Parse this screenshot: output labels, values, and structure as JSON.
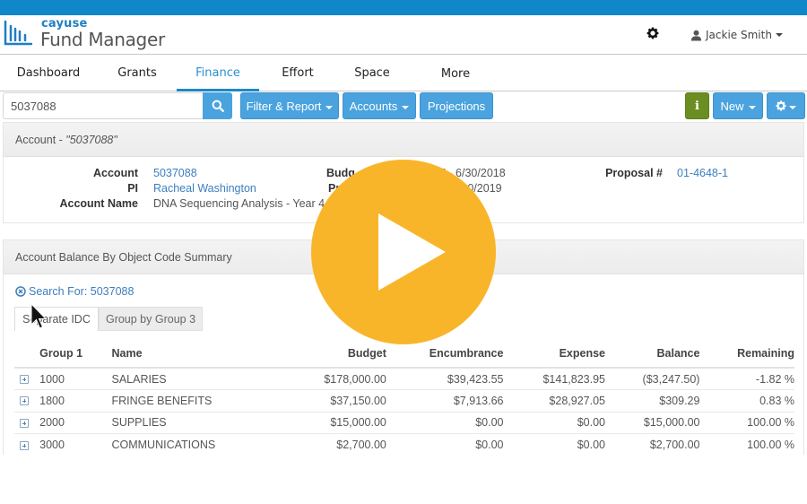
{
  "header": {
    "brand": "cayuse",
    "product": "Fund Manager",
    "settings_icon": "gear-icon",
    "user_name": "Jackie Smith",
    "user_icon": "user-icon"
  },
  "nav": {
    "tabs": [
      {
        "label": "Dashboard",
        "active": false
      },
      {
        "label": "Grants",
        "active": false
      },
      {
        "label": "Finance",
        "active": true
      },
      {
        "label": "Effort",
        "active": false
      },
      {
        "label": "Space",
        "active": false
      },
      {
        "label": "More",
        "active": false
      }
    ]
  },
  "toolbar": {
    "search_value": "5037088",
    "search_icon": "search-icon",
    "filter_report_label": "Filter & Report",
    "accounts_label": "Accounts",
    "projections_label": "Projections",
    "info_label": "i",
    "new_label": "New",
    "settings_icon": "gear-icon"
  },
  "account_panel": {
    "title_prefix": "Account - ",
    "title_value": "\"5037088\"",
    "fields": {
      "account_label": "Account",
      "account_value": "5037088",
      "pi_label": "PI",
      "pi_value": "Racheal Washington",
      "account_name_label": "Account Name",
      "account_name_value": "DNA Sequencing Analysis - Year 4",
      "budget_label": "Budg",
      "budget_value": "7 - 6/30/2018",
      "project_label": "Pr",
      "project_value": "6/30/2019",
      "proposal_label": "Proposal #",
      "proposal_value": "01-4648-1"
    }
  },
  "summary_panel": {
    "title": "Account Balance By Object Code Summary",
    "search_for": "Search For: 5037088",
    "subtabs": [
      {
        "label": "Separate IDC",
        "active": true
      },
      {
        "label": "Group by Group 3",
        "active": false
      }
    ],
    "table": {
      "headers": [
        "Group 1",
        "Name",
        "Budget",
        "Encumbrance",
        "Expense",
        "Balance",
        "Remaining"
      ],
      "rows": [
        {
          "group": "1000",
          "name": "SALARIES",
          "budget": "$178,000.00",
          "encumbrance": "$39,423.55",
          "expense": "$141,823.95",
          "balance": "($3,247.50)",
          "balance_negative": true,
          "remaining": "-1.82 %"
        },
        {
          "group": "1800",
          "name": "FRINGE BENEFITS",
          "budget": "$37,150.00",
          "encumbrance": "$7,913.66",
          "expense": "$28,927.05",
          "balance": "$309.29",
          "balance_negative": false,
          "remaining": "0.83 %"
        },
        {
          "group": "2000",
          "name": "SUPPLIES",
          "budget": "$15,000.00",
          "encumbrance": "$0.00",
          "expense": "$0.00",
          "balance": "$15,000.00",
          "balance_negative": false,
          "remaining": "100.00 %"
        },
        {
          "group": "3000",
          "name": "COMMUNICATIONS",
          "budget": "$2,700.00",
          "encumbrance": "$0.00",
          "expense": "$0.00",
          "balance": "$2,700.00",
          "balance_negative": false,
          "remaining": "100.00 %"
        }
      ]
    }
  },
  "overlay": {
    "play_icon": "play-icon",
    "color": "#f9b52a"
  },
  "colors": {
    "top_bar": "#0f87c9",
    "primary_button": "#4aa3de",
    "info_button": "#6b8e23",
    "link": "#3d7ebf",
    "negative": "#b26b6b"
  }
}
